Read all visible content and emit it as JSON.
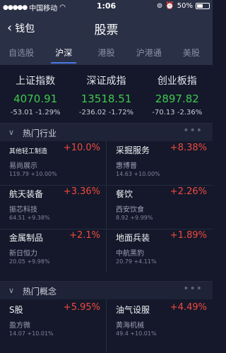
{
  "status_bar": {
    "signal": "●●●●●",
    "carrier": "中国移动",
    "wifi": "◠",
    "time": "1:06",
    "battery": "50%"
  },
  "nav": {
    "back_label": "钱包",
    "title": "股票"
  },
  "tabs": [
    {
      "label": "自选股"
    },
    {
      "label": "沪深"
    },
    {
      "label": "港股"
    },
    {
      "label": "沪港通"
    },
    {
      "label": "美股"
    }
  ],
  "indices": [
    {
      "name": "上证指数",
      "value": "4070.91",
      "change": "-53.01 -1.29%"
    },
    {
      "name": "深证成指",
      "value": "13518.51",
      "change": "-236.02 -1.72%"
    },
    {
      "name": "创业板指",
      "value": "2897.82",
      "change": "-70.13 -2.36%"
    }
  ],
  "hot_industries": {
    "title": "热门行业",
    "more": "•••",
    "items": [
      {
        "name": "其他轻工制造",
        "pct": "+10.0%",
        "lead_name": "易尚展示",
        "lead_change": "119.79 +10.00%"
      },
      {
        "name": "采掘服务",
        "pct": "+8.38%",
        "lead_name": "惠博普",
        "lead_change": "14.63 +10.00%"
      },
      {
        "name": "航天装备",
        "pct": "+3.36%",
        "lead_name": "振芯科技",
        "lead_change": "64.51 +9.38%"
      },
      {
        "name": "餐饮",
        "pct": "+2.26%",
        "lead_name": "西安饮食",
        "lead_change": "8.92 +9.99%"
      },
      {
        "name": "金属制品",
        "pct": "+2.1%",
        "lead_name": "新日恒力",
        "lead_change": "20.05 +9.98%"
      },
      {
        "name": "地面兵装",
        "pct": "+1.89%",
        "lead_name": "中航黑豹",
        "lead_change": "20.79 +4.11%"
      }
    ]
  },
  "hot_concepts": {
    "title": "热门概念",
    "more": "•••",
    "items": [
      {
        "name": "S股",
        "pct": "+5.95%",
        "lead_name": "盈方微",
        "lead_change": "14.07 +10.01%"
      },
      {
        "name": "油气设服",
        "pct": "+4.49%",
        "lead_name": "黄海机械",
        "lead_change": "49.4 +10.01%"
      }
    ]
  },
  "colors": {
    "rise": "#f04a3e",
    "index_value": "#3fc94d",
    "accent": "#4a78e6"
  }
}
